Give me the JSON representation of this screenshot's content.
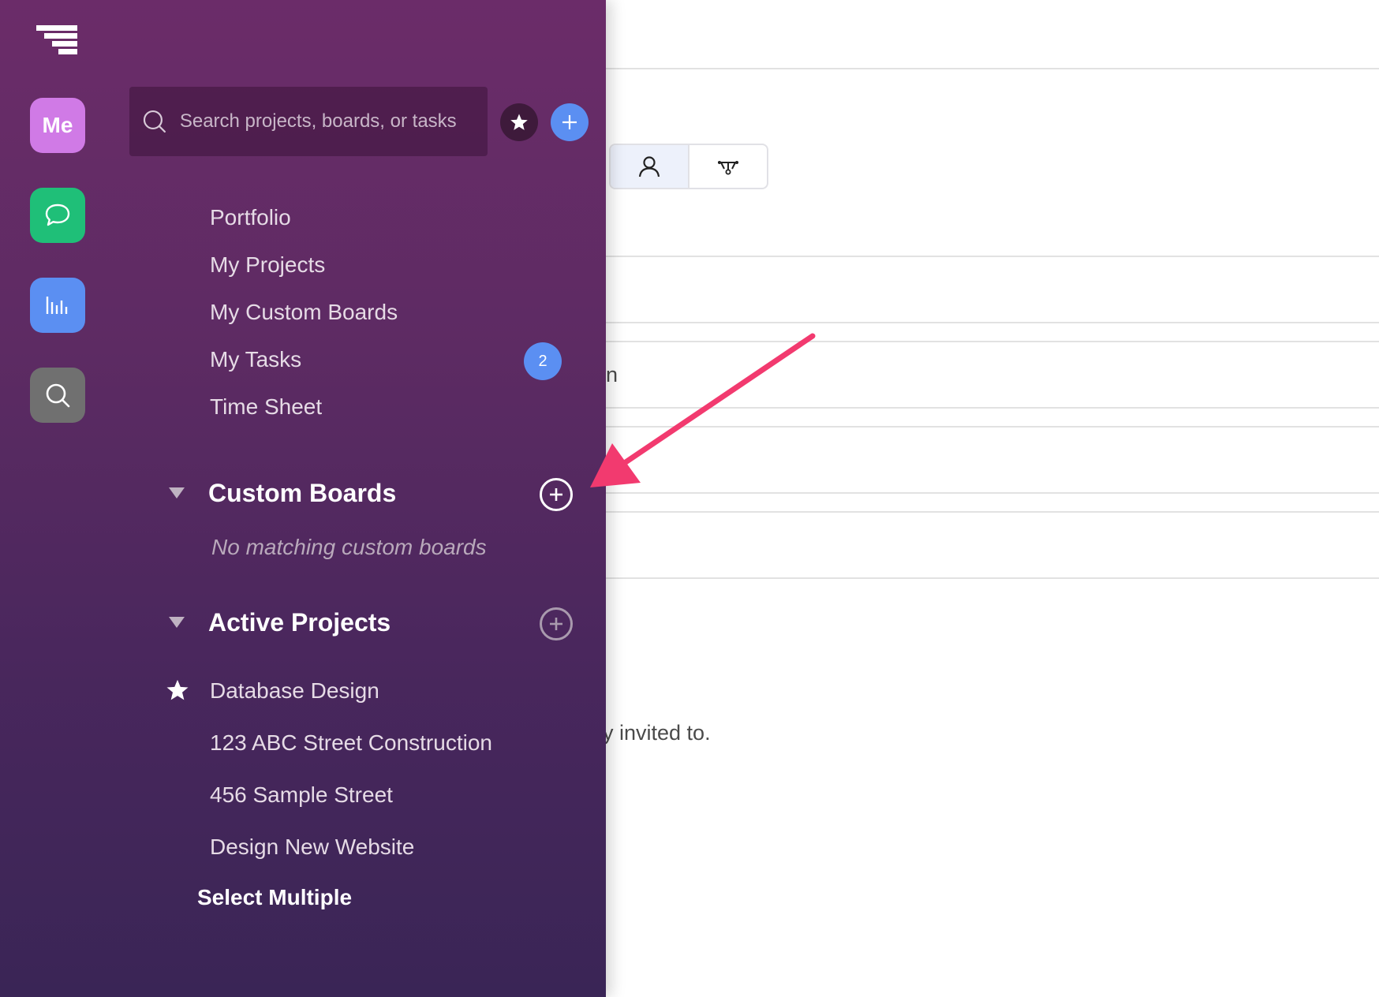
{
  "background": {
    "partial_text_1": "n",
    "partial_text_2": "y invited to."
  },
  "sidebar": {
    "rail": {
      "me_label": "Me"
    },
    "search": {
      "placeholder": "Search projects, boards, or tasks",
      "value": ""
    },
    "nav_items": [
      {
        "label": "Portfolio"
      },
      {
        "label": "My Projects"
      },
      {
        "label": "My Custom Boards"
      },
      {
        "label": "My Tasks",
        "badge": "2"
      },
      {
        "label": "Time Sheet"
      }
    ],
    "custom_boards": {
      "title": "Custom Boards",
      "empty_text": "No matching custom boards"
    },
    "active_projects": {
      "title": "Active Projects",
      "items": [
        {
          "label": "Database Design",
          "starred": true
        },
        {
          "label": "123 ABC Street Construction",
          "starred": false
        },
        {
          "label": "456 Sample Street",
          "starred": false
        },
        {
          "label": "Design New Website",
          "starred": false
        }
      ],
      "select_multiple": "Select Multiple"
    }
  },
  "colors": {
    "drawer_top": "#6b2c69",
    "drawer_bottom": "#3a2556",
    "accent_blue": "#5b8ff2",
    "me_pink": "#d07ae6",
    "chat_green": "#1fbf78",
    "annotation_arrow": "#f23a6f"
  },
  "icons": {
    "logo": "stacked-bars-logo",
    "chat": "chat-bubble-icon",
    "reports": "bar-chart-icon",
    "search": "search-icon",
    "favorites": "star-icon",
    "add": "plus-icon",
    "user_view": "user-icon",
    "hierarchy_view": "hierarchy-icon"
  }
}
